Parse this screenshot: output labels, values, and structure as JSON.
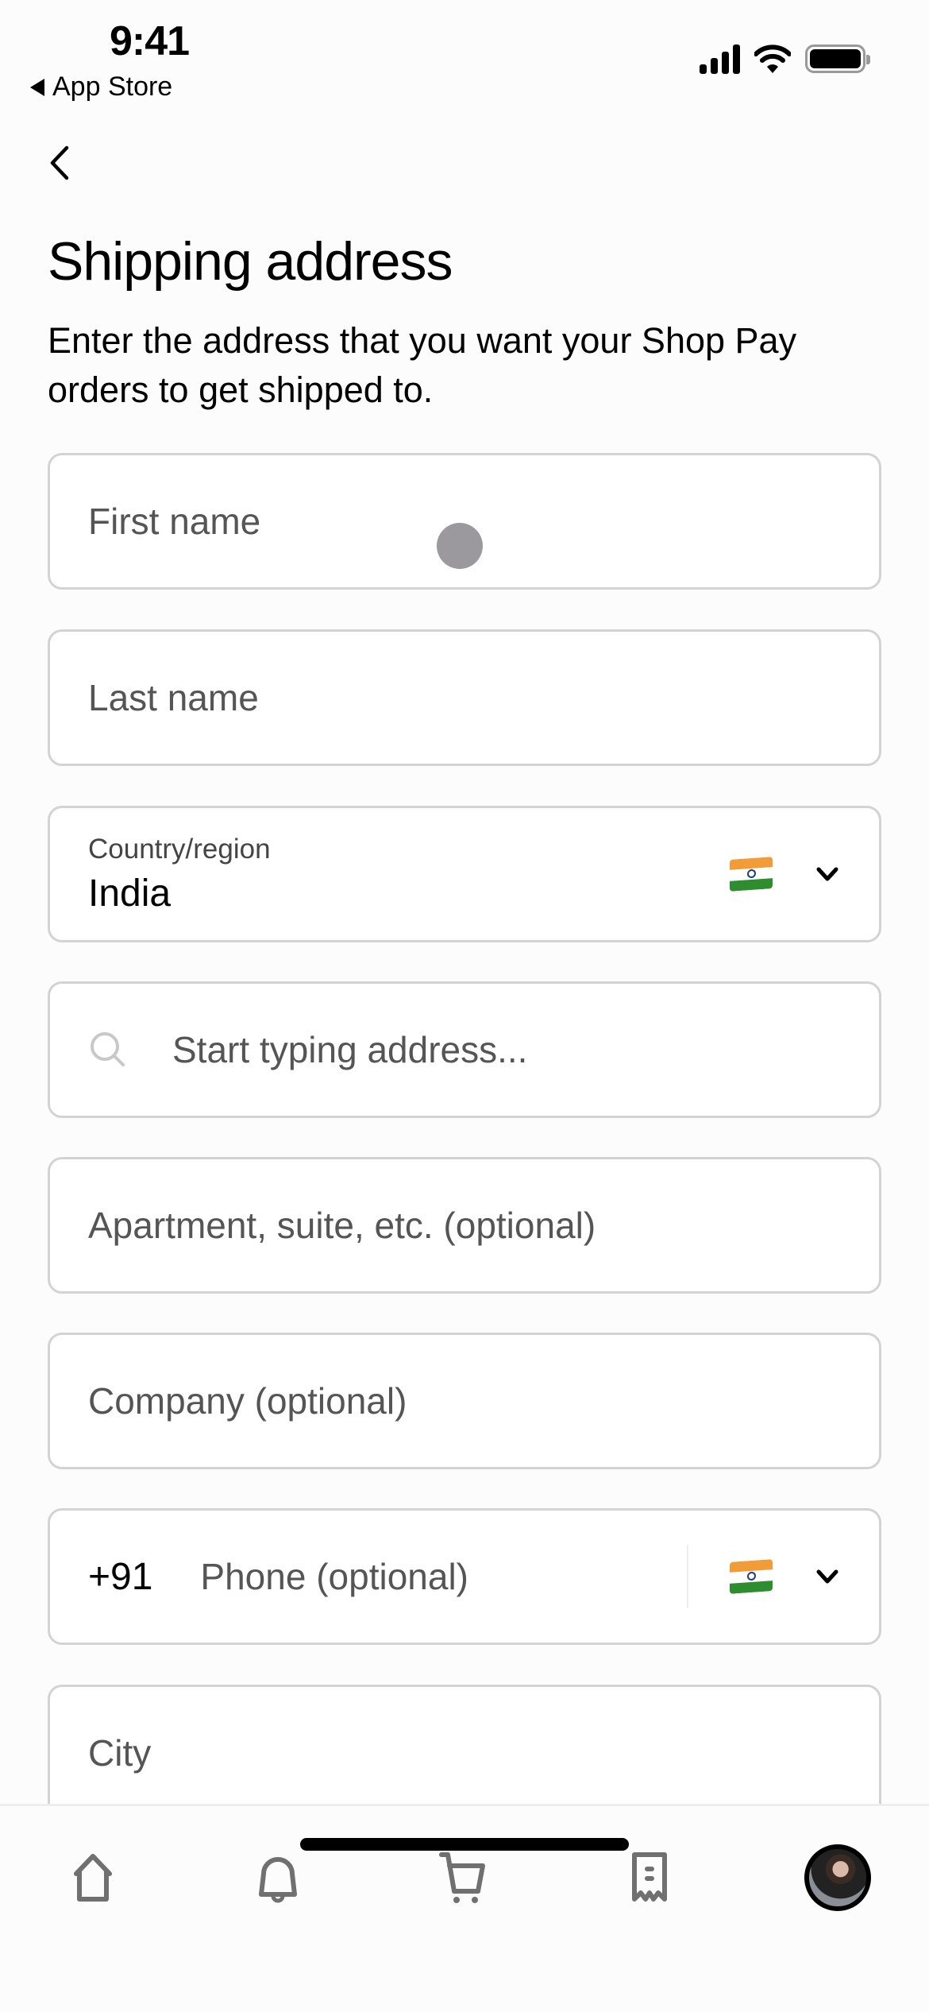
{
  "status_bar": {
    "time": "9:41",
    "back_app": "App Store",
    "icons": [
      "cellular-signal-icon",
      "wifi-icon",
      "battery-icon"
    ]
  },
  "nav": {
    "back_icon": "chevron-left-icon"
  },
  "header": {
    "title": "Shipping address",
    "subtitle": "Enter the address that you want your Shop Pay orders to get shipped to."
  },
  "form": {
    "first_name": {
      "placeholder": "First name",
      "value": ""
    },
    "last_name": {
      "placeholder": "Last name",
      "value": ""
    },
    "country": {
      "label": "Country/region",
      "value": "India",
      "flag": "india-flag"
    },
    "address_search": {
      "placeholder": "Start typing address...",
      "icon": "search-icon"
    },
    "apartment": {
      "placeholder": "Apartment, suite, etc. (optional)"
    },
    "company": {
      "placeholder": "Company (optional)"
    },
    "phone": {
      "country_code": "+91",
      "placeholder": "Phone (optional)",
      "flag": "india-flag"
    },
    "city": {
      "placeholder": "City"
    }
  },
  "tabbar": {
    "items": [
      {
        "name": "home",
        "icon": "home-icon"
      },
      {
        "name": "notifications",
        "icon": "bell-icon"
      },
      {
        "name": "cart",
        "icon": "cart-icon"
      },
      {
        "name": "orders",
        "icon": "receipt-icon"
      },
      {
        "name": "profile",
        "icon": "avatar"
      }
    ],
    "icon_color": "#707070"
  }
}
